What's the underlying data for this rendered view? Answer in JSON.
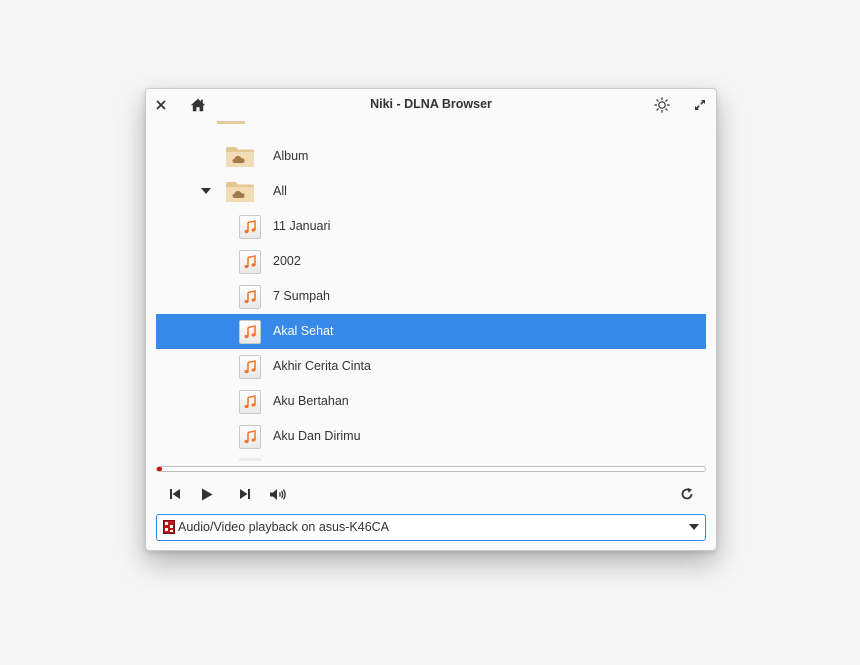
{
  "window": {
    "title": "Niki - DLNA Browser"
  },
  "titlebar": {
    "close_icon": "close-icon",
    "home_icon": "home-icon",
    "theme_icon": "brightness-icon",
    "maximize_icon": "maximize-icon"
  },
  "tree": {
    "folders": [
      {
        "label": "Album",
        "icon": "folder-cloud-icon"
      },
      {
        "label": "All",
        "icon": "folder-cloud-icon",
        "expanded": true
      }
    ],
    "tracks": [
      {
        "label": "11 Januari"
      },
      {
        "label": "2002"
      },
      {
        "label": "7 Sumpah"
      },
      {
        "label": "Akal Sehat",
        "selected": true
      },
      {
        "label": "Akhir Cerita Cinta"
      },
      {
        "label": "Aku Bertahan"
      },
      {
        "label": "Aku Dan Dirimu"
      }
    ],
    "selected_track": "Akal Sehat"
  },
  "player": {
    "progress": 0.01,
    "controls": [
      "previous-icon",
      "play-icon",
      "next-icon",
      "volume-icon"
    ],
    "refresh_icon": "refresh-icon"
  },
  "renderer": {
    "selected": "Audio/Video playback on asus-K46CA"
  },
  "colors": {
    "accent": "#3689e6",
    "progress": "#d90000",
    "folder": "#e6c99a",
    "note": "#f37329"
  }
}
